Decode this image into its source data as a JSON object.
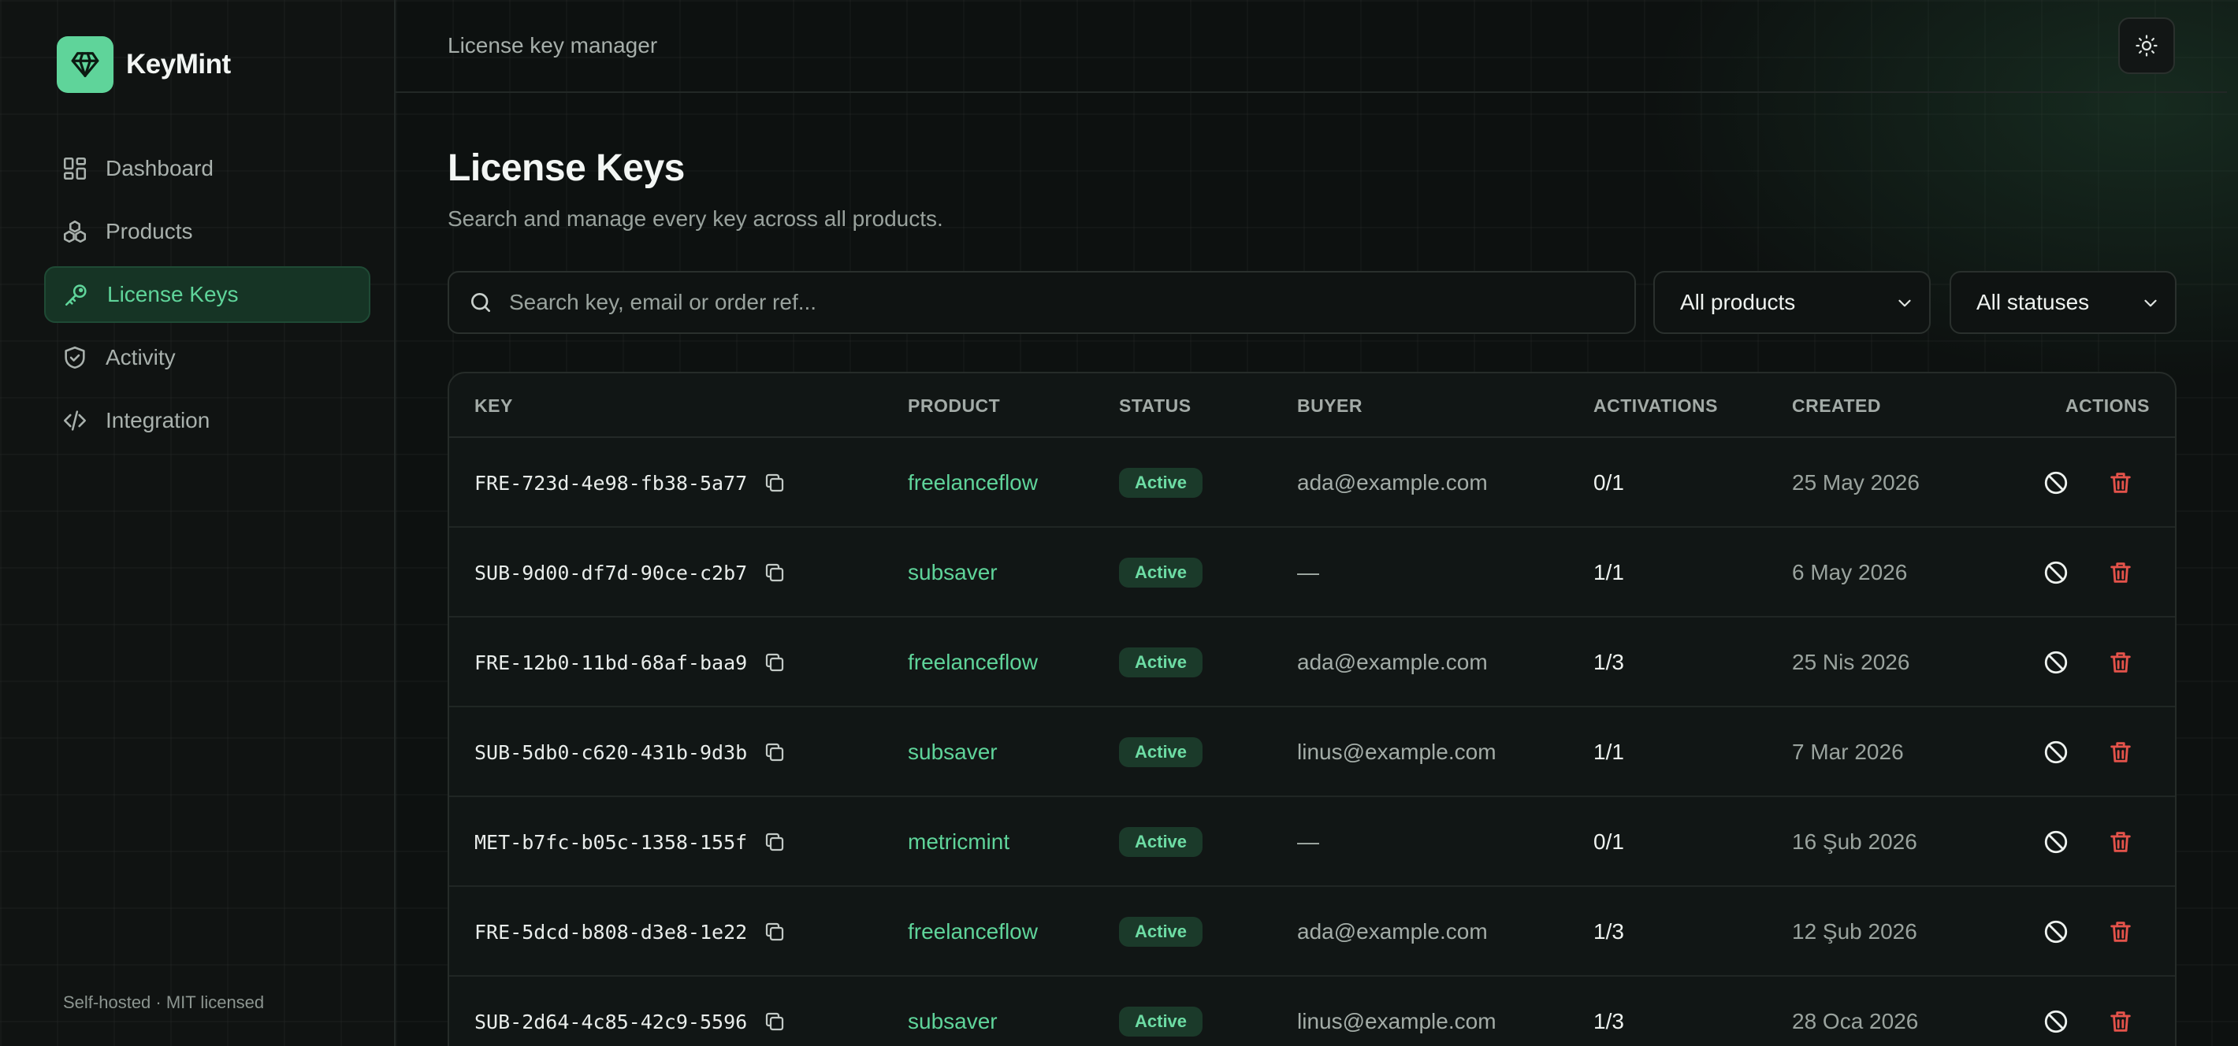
{
  "brand": {
    "name": "KeyMint"
  },
  "sidebar": {
    "items": [
      {
        "label": "Dashboard",
        "icon": "dashboard-icon",
        "active": false
      },
      {
        "label": "Products",
        "icon": "boxes-icon",
        "active": false
      },
      {
        "label": "License Keys",
        "icon": "key-icon",
        "active": true
      },
      {
        "label": "Activity",
        "icon": "shield-check-icon",
        "active": false
      },
      {
        "label": "Integration",
        "icon": "code-icon",
        "active": false
      }
    ],
    "footer": "Self-hosted · MIT licensed"
  },
  "topbar": {
    "title": "License key manager",
    "theme_icon": "sun-icon"
  },
  "page": {
    "title": "License Keys",
    "subtitle": "Search and manage every key across all products."
  },
  "search": {
    "placeholder": "Search key, email or order ref...",
    "value": ""
  },
  "filters": {
    "product": "All products",
    "status": "All statuses"
  },
  "colors": {
    "accent": "#5fd49a",
    "danger": "#e5534b",
    "background": "#0d1110"
  },
  "table": {
    "headers": {
      "key": "KEY",
      "product": "PRODUCT",
      "status": "STATUS",
      "buyer": "BUYER",
      "activations": "ACTIVATIONS",
      "created": "CREATED",
      "actions": "ACTIONS"
    },
    "rows": [
      {
        "key": "FRE-723d-4e98-fb38-5a77",
        "product": "freelanceflow",
        "status": "Active",
        "buyer": "ada@example.com",
        "activations": "0/1",
        "created": "25 May 2026"
      },
      {
        "key": "SUB-9d00-df7d-90ce-c2b7",
        "product": "subsaver",
        "status": "Active",
        "buyer": "—",
        "activations": "1/1",
        "created": "6 May 2026"
      },
      {
        "key": "FRE-12b0-11bd-68af-baa9",
        "product": "freelanceflow",
        "status": "Active",
        "buyer": "ada@example.com",
        "activations": "1/3",
        "created": "25 Nis 2026"
      },
      {
        "key": "SUB-5db0-c620-431b-9d3b",
        "product": "subsaver",
        "status": "Active",
        "buyer": "linus@example.com",
        "activations": "1/1",
        "created": "7 Mar 2026"
      },
      {
        "key": "MET-b7fc-b05c-1358-155f",
        "product": "metricmint",
        "status": "Active",
        "buyer": "—",
        "activations": "0/1",
        "created": "16 Şub 2026"
      },
      {
        "key": "FRE-5dcd-b808-d3e8-1e22",
        "product": "freelanceflow",
        "status": "Active",
        "buyer": "ada@example.com",
        "activations": "1/3",
        "created": "12 Şub 2026"
      },
      {
        "key": "SUB-2d64-4c85-42c9-5596",
        "product": "subsaver",
        "status": "Active",
        "buyer": "linus@example.com",
        "activations": "1/3",
        "created": "28 Oca 2026"
      }
    ]
  }
}
